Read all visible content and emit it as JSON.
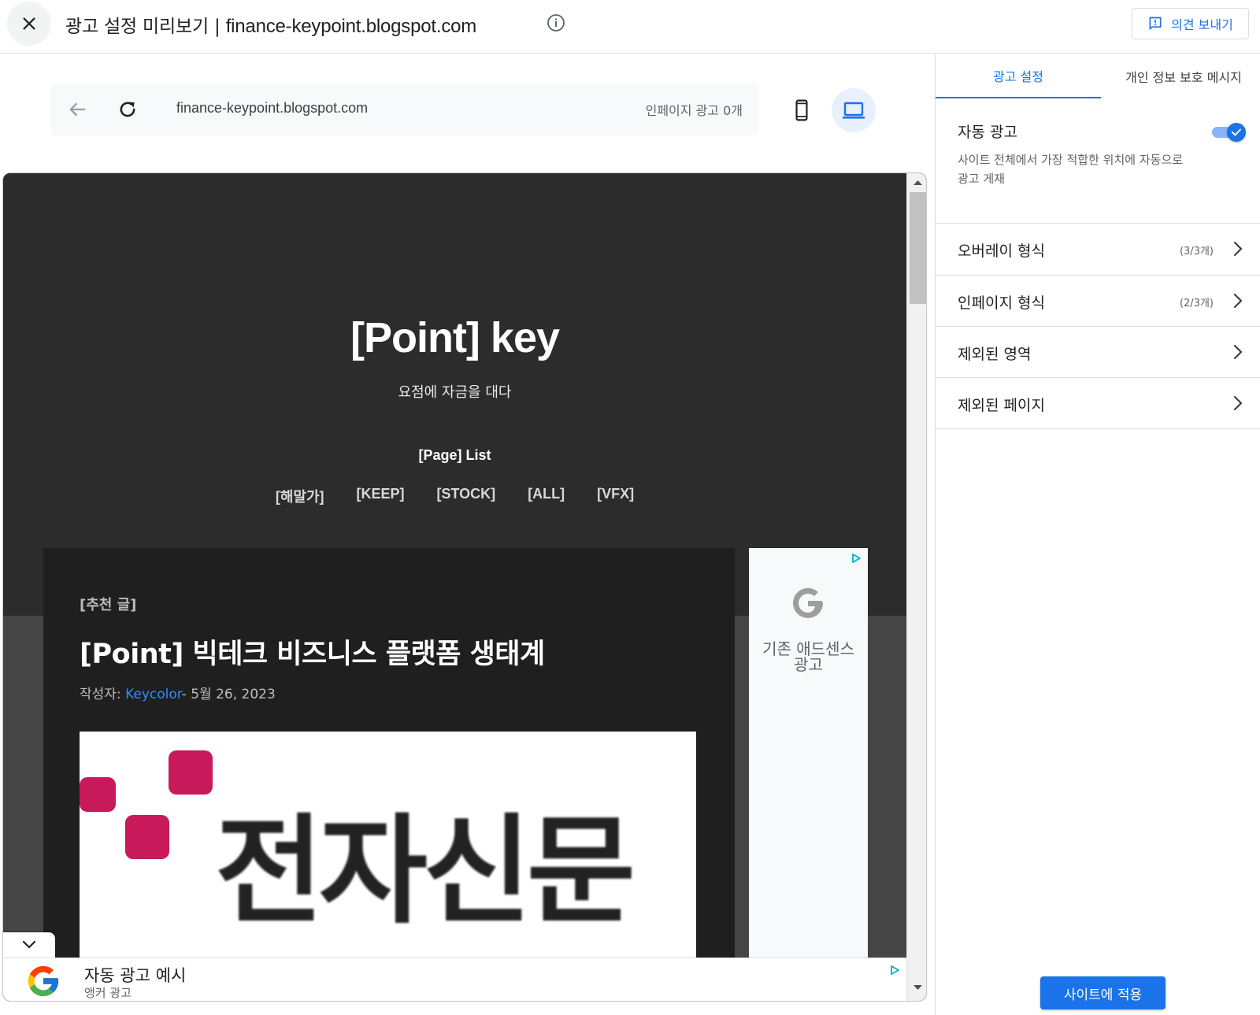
{
  "topbar": {
    "title_prefix": "광고 설정 미리보기 | ",
    "title_domain": "finance-keypoint.blogspot.com",
    "feedback_label": "의견 보내기"
  },
  "preview": {
    "url": "finance-keypoint.blogspot.com",
    "inpage_ads_count": "인페이지 광고 0개"
  },
  "site": {
    "title": "[Point] key",
    "subtitle": "요점에 자금을 대다",
    "page_list": "[Page] List",
    "menu": [
      "[해말가]",
      "[KEEP]",
      "[STOCK]",
      "[ALL]",
      "[VFX]"
    ],
    "post": {
      "label": "[추천 글]",
      "title": "[Point] 빅테크 비즈니스 플랫폼 생태계",
      "author_prefix": "작성자: ",
      "author": "Keycolor",
      "date": "- 5월 26, 2023",
      "image_text": "전자신문"
    },
    "side_ad": {
      "line1": "기존 애드센스",
      "line2": "광고"
    },
    "anchor_ad": {
      "title": "자동 광고 예시",
      "subtitle": "앵커 광고"
    }
  },
  "panel": {
    "tabs": [
      "광고 설정",
      "개인 정보 보호 메시지"
    ],
    "auto_ads": {
      "title": "자동 광고",
      "description": "사이트 전체에서 가장 적합한 위치에 자동으로 광고 게재",
      "enabled": true
    },
    "rows": [
      {
        "label": "오버레이 형식",
        "count": "(3/3개)"
      },
      {
        "label": "인페이지 형식",
        "count": "(2/3개)"
      },
      {
        "label": "제외된 영역",
        "count": ""
      },
      {
        "label": "제외된 페이지",
        "count": ""
      }
    ],
    "apply_label": "사이트에 적용"
  },
  "colors": {
    "accent": "#1a73e8",
    "toggle_track": "#8ab4f8",
    "site_header_bg": "#2c2c2c",
    "site_body_bg": "#454545",
    "post_bg": "#1f1f1f",
    "etnews_red": "#c8195a",
    "link_blue": "#2f8cff"
  },
  "icons": {
    "close": "close-icon",
    "info": "info-icon",
    "feedback": "feedback-icon",
    "back": "arrow-back-icon",
    "reload": "reload-icon",
    "mobile": "mobile-phone-icon",
    "desktop": "laptop-icon",
    "ad_choices": "ad-choices-icon",
    "google": "google-g-icon",
    "chevron": "chevron-right-icon"
  }
}
